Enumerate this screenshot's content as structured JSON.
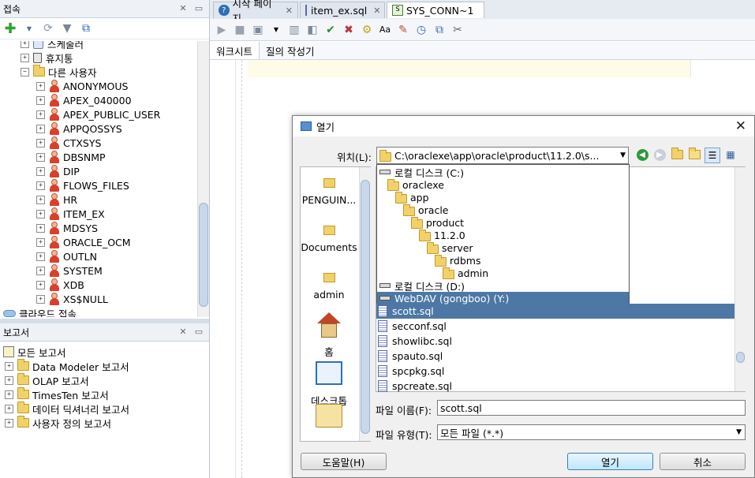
{
  "connections": {
    "title": "접속",
    "tree": [
      {
        "label": "스케줄러",
        "indent": 2,
        "icon": "scheduler-icon"
      },
      {
        "label": "휴지통",
        "indent": 2,
        "icon": "recycle-bin-icon"
      },
      {
        "label": "다른 사용자",
        "indent": 2,
        "icon": "other-users-icon",
        "expanded": true
      },
      {
        "label": "ANONYMOUS",
        "indent": 3,
        "icon": "user-icon"
      },
      {
        "label": "APEX_040000",
        "indent": 3,
        "icon": "user-icon"
      },
      {
        "label": "APEX_PUBLIC_USER",
        "indent": 3,
        "icon": "user-icon"
      },
      {
        "label": "APPQOSSYS",
        "indent": 3,
        "icon": "user-icon"
      },
      {
        "label": "CTXSYS",
        "indent": 3,
        "icon": "user-icon"
      },
      {
        "label": "DBSNMP",
        "indent": 3,
        "icon": "user-icon"
      },
      {
        "label": "DIP",
        "indent": 3,
        "icon": "user-icon"
      },
      {
        "label": "FLOWS_FILES",
        "indent": 3,
        "icon": "user-icon"
      },
      {
        "label": "HR",
        "indent": 3,
        "icon": "user-icon"
      },
      {
        "label": "ITEM_EX",
        "indent": 3,
        "icon": "user-icon"
      },
      {
        "label": "MDSYS",
        "indent": 3,
        "icon": "user-icon"
      },
      {
        "label": "ORACLE_OCM",
        "indent": 3,
        "icon": "user-icon"
      },
      {
        "label": "OUTLN",
        "indent": 3,
        "icon": "user-icon"
      },
      {
        "label": "SYSTEM",
        "indent": 3,
        "icon": "user-icon"
      },
      {
        "label": "XDB",
        "indent": 3,
        "icon": "user-icon"
      },
      {
        "label": "XS$NULL",
        "indent": 3,
        "icon": "user-icon"
      }
    ],
    "cloud": "클라우드 접속"
  },
  "reports": {
    "title": "보고서",
    "root": "모든 보고서",
    "items": [
      "Data Modeler 보고서",
      "OLAP 보고서",
      "TimesTen 보고서",
      "데이터 딕셔너리 보고서",
      "사용자 정의 보고서"
    ]
  },
  "tabs": [
    {
      "label": "시작 페이지",
      "icon": "help-icon"
    },
    {
      "label": "item_ex.sql",
      "icon": "sql-file-icon"
    },
    {
      "label": "SYS_CONN~1",
      "icon": "sql-worksheet-icon",
      "active": true
    }
  ],
  "subtabs": [
    "워크시트",
    "질의 작성기"
  ],
  "dialog": {
    "title": "열기",
    "location_label": "위치(L):",
    "location_value": "C:\\oraclexe\\app\\oracle\\product\\11.2.0\\s...",
    "dropdown": [
      {
        "label": "로컬 디스크 (C:)",
        "type": "drive",
        "level": 0
      },
      {
        "label": "oraclexe",
        "type": "folder",
        "level": 1
      },
      {
        "label": "app",
        "type": "folder",
        "level": 2
      },
      {
        "label": "oracle",
        "type": "folder",
        "level": 3
      },
      {
        "label": "product",
        "type": "folder",
        "level": 4
      },
      {
        "label": "11.2.0",
        "type": "folder",
        "level": 5
      },
      {
        "label": "server",
        "type": "folder",
        "level": 6
      },
      {
        "label": "rdbms",
        "type": "folder",
        "level": 7
      },
      {
        "label": "admin",
        "type": "folder",
        "level": 8
      },
      {
        "label": "로컬 디스크 (D:)",
        "type": "drive",
        "level": 0
      },
      {
        "label": "WebDAV (gongboo) (Y:)",
        "type": "drive",
        "level": 0,
        "selected": true
      }
    ],
    "places": [
      "PENGUIN...",
      "Documents",
      "admin",
      "홈",
      "데스크톱"
    ],
    "files": [
      {
        "name": "scott.sql",
        "selected": true
      },
      {
        "name": "secconf.sql"
      },
      {
        "name": "showlibc.sql"
      },
      {
        "name": "spauto.sql"
      },
      {
        "name": "spcpkg.sql"
      },
      {
        "name": "spcreate.sql"
      }
    ],
    "filename_label": "파일 이름(F):",
    "filename_value": "scott.sql",
    "filetype_label": "파일 유형(T):",
    "filetype_value": "모든 파일 (*.*)",
    "help_button": "도움말(H)",
    "open_button": "열기",
    "cancel_button": "취소"
  },
  "colors": {
    "selection": "#4d78a5",
    "accent": "#3c7fb1"
  }
}
